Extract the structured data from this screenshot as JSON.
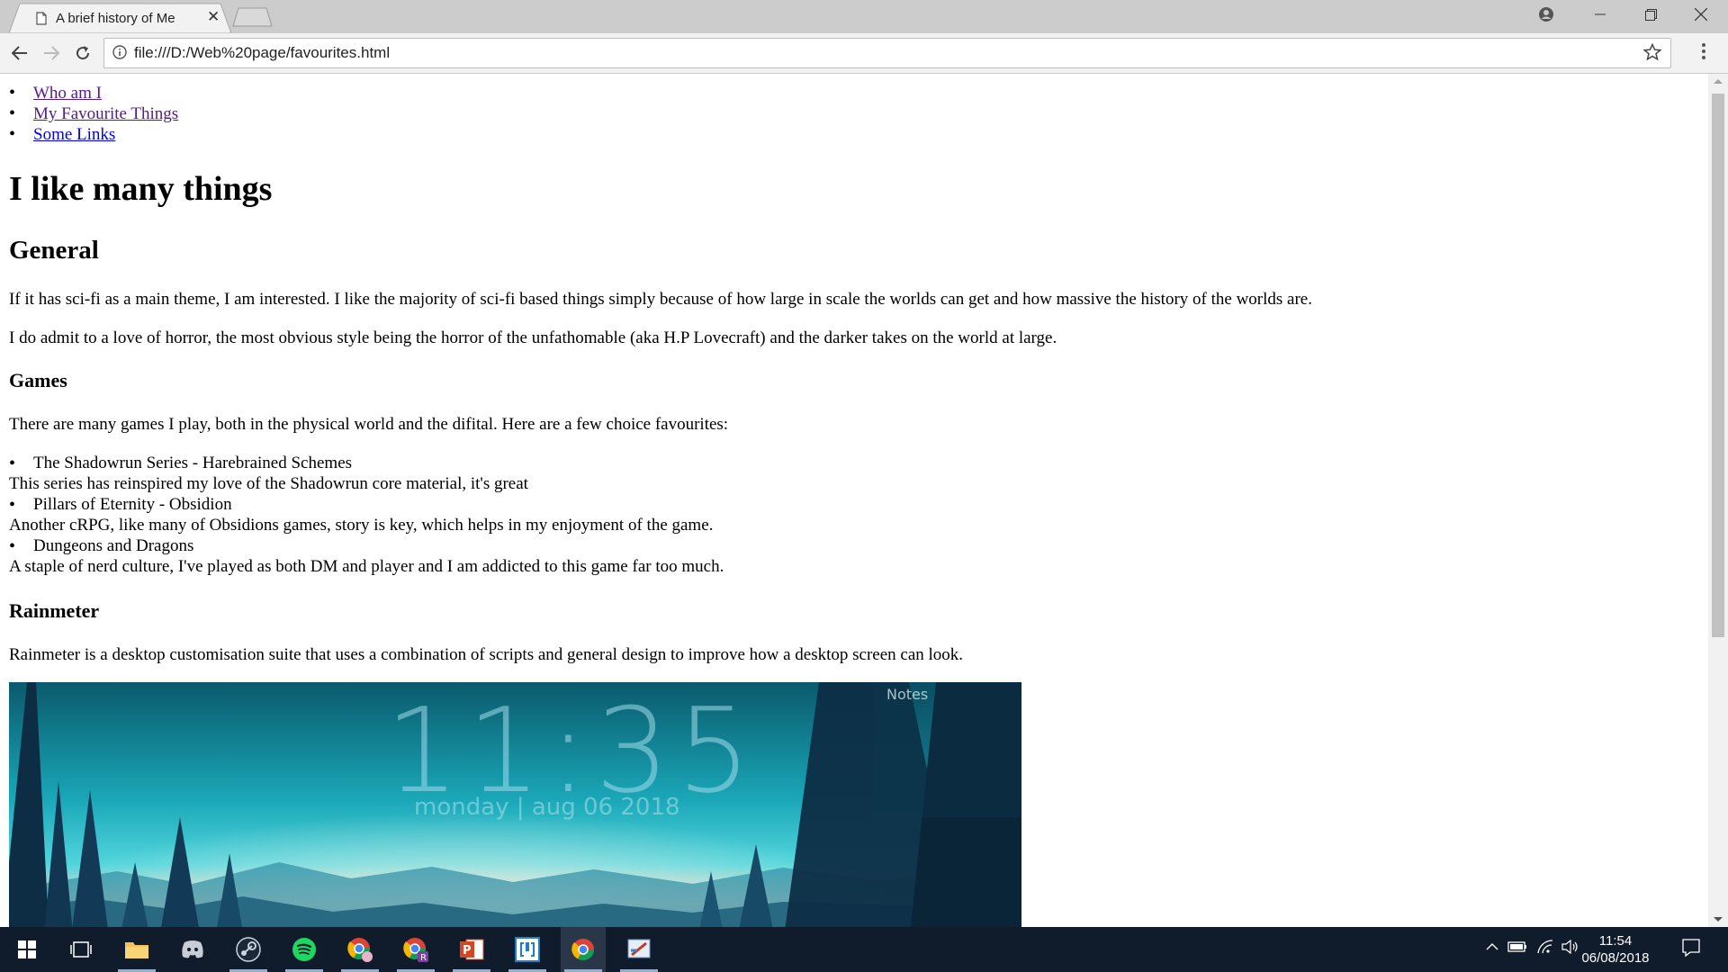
{
  "browser": {
    "tab_title": "A brief history of Me",
    "url": "file:///D:/Web%20page/favourites.html"
  },
  "nav": {
    "items": [
      {
        "label": "Who am I",
        "visited": true
      },
      {
        "label": "My Favourite Things",
        "visited": true
      },
      {
        "label": "Some Links",
        "visited": false
      }
    ]
  },
  "content": {
    "h1": "I like many things",
    "general_heading": "General",
    "general_p1": "If it has sci-fi as a main theme, I am interested. I like the majority of sci-fi based things simply because of how large in scale the worlds can get and how massive the history of the worlds are.",
    "general_p2": "I do admit to a love of horror, the most obvious style being the horror of the unfathomable (aka H.P Lovecraft) and the darker takes on the world at large.",
    "games_heading": "Games",
    "games_intro": "There are many games I play, both in the physical world and the difital. Here are a few choice favourites:",
    "games": [
      {
        "title": "The Shadowrun Series - Harebrained Schemes",
        "desc": "This series has reinspired my love of the Shadowrun core material, it's great"
      },
      {
        "title": "Pillars of Eternity - Obsidion",
        "desc": "Another cRPG, like many of Obsidions games, story is key, which helps in my enjoyment of the game."
      },
      {
        "title": "Dungeons and Dragons",
        "desc": "A staple of nerd culture, I've played as both DM and player and I am addicted to this game far too much."
      }
    ],
    "rainmeter_heading": "Rainmeter",
    "rainmeter_p": "Rainmeter is a desktop customisation suite that uses a combination of scripts and general design to improve how a desktop screen can look.",
    "rainmeter_image": {
      "clock_time": "11:35",
      "clock_date": "monday | aug 06 2018",
      "notes_label": "Notes"
    }
  },
  "taskbar": {
    "time": "11:54",
    "date": "06/08/2018"
  }
}
